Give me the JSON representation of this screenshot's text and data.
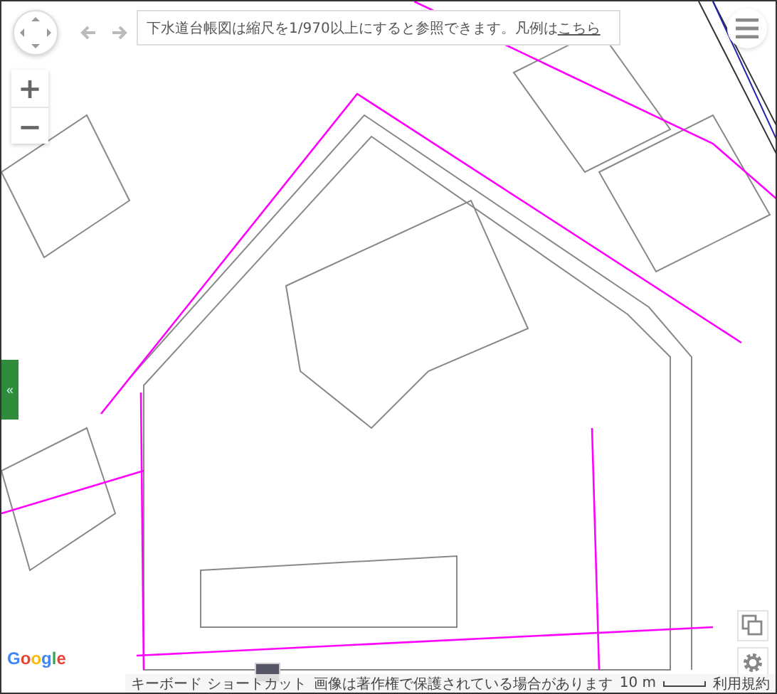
{
  "notice": {
    "text": "下水道台帳図は縮尺を1/970以上にすると参照できます。凡例は",
    "link": "こちら"
  },
  "zoom": {
    "in": "+",
    "out": "−"
  },
  "sidebar_toggle": {
    "label": "«"
  },
  "logo": "Google",
  "footer": {
    "shortcuts": "キーボード ショートカット",
    "copyright": "画像は著作権で保護されている場合があります",
    "scale": "10 m",
    "terms": "利用規約"
  }
}
